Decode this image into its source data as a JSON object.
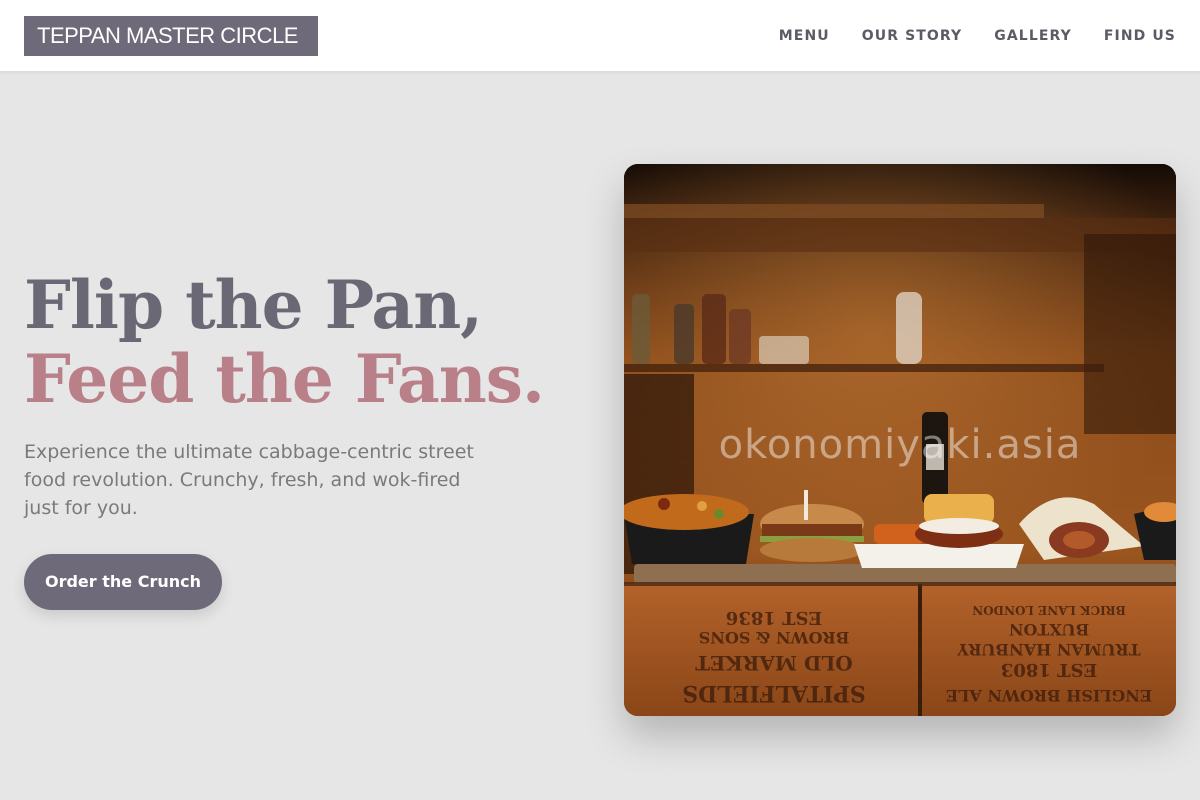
{
  "header": {
    "logo_text": "TEPPAN MASTER CIRCLE",
    "nav": [
      {
        "label": "MENU"
      },
      {
        "label": "OUR STORY"
      },
      {
        "label": "GALLERY"
      },
      {
        "label": "FIND US"
      }
    ]
  },
  "hero": {
    "headline_line1": "Flip the Pan,",
    "headline_line2": "Feed the Fans.",
    "subtext": "Experience the ultimate cabbage-centric street food revolution. Crunchy, fresh, and wok-fired just for you.",
    "cta_label": "Order the Crunch",
    "image": {
      "watermark": "okonomiyaki.asia",
      "crate_text_left": [
        "EST 1836",
        "BROWN & SONS",
        "OLD MARKET",
        "SPITALFIELDS"
      ],
      "crate_text_right": [
        "BRICK LANE LONDON",
        "BUXTON",
        "TRUMAN HANBURY",
        "EST 1803",
        "ENGLISH BROWN ALE"
      ]
    }
  },
  "colors": {
    "background": "#e6e6e6",
    "header_bg": "#ffffff",
    "brand_gray": "#6e6a79",
    "accent_rose": "#b98089",
    "body_text": "#7a7a7a"
  }
}
